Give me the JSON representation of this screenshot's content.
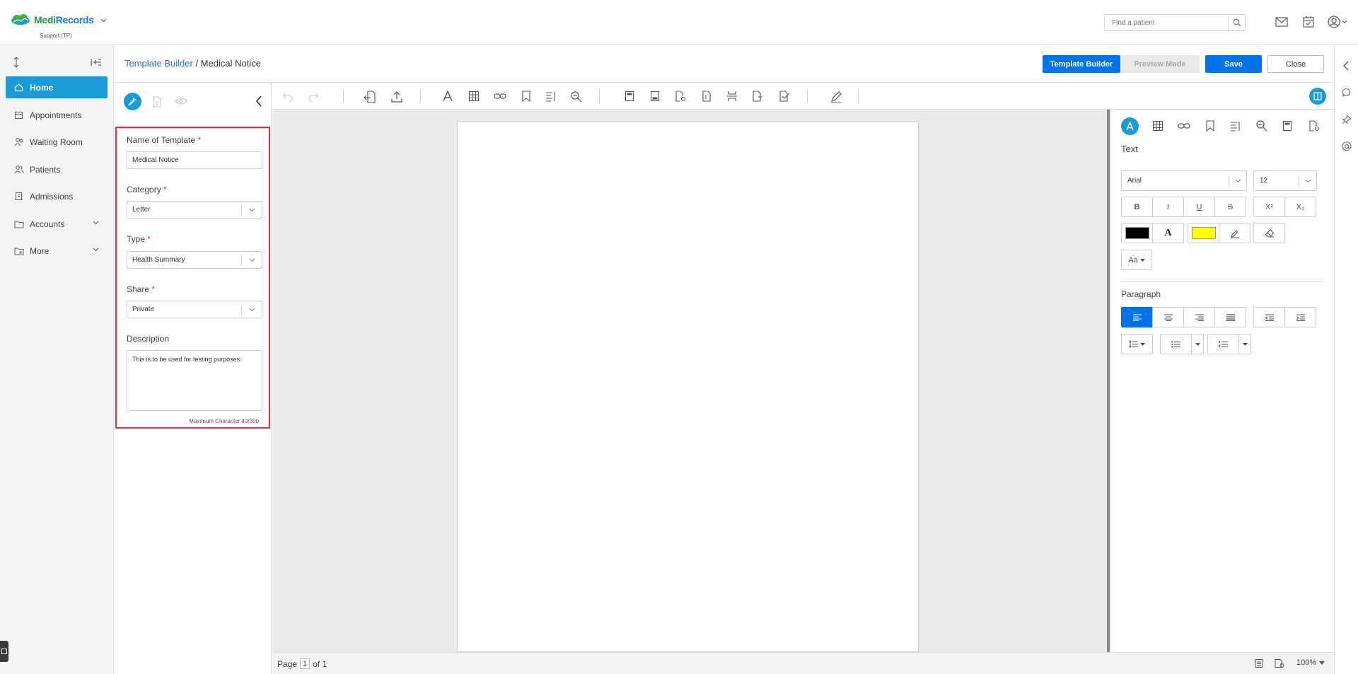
{
  "header": {
    "brand": "MediRecords",
    "brand_prefix": "Medi",
    "brand_suffix": "Records",
    "org": "Support (TP)",
    "search_placeholder": "Find a patient"
  },
  "sidebar": {
    "items": [
      {
        "label": "Home",
        "icon": "home-icon",
        "active": true
      },
      {
        "label": "Appointments",
        "icon": "calendar-icon"
      },
      {
        "label": "Waiting Room",
        "icon": "users-icon"
      },
      {
        "label": "Patients",
        "icon": "people-icon"
      },
      {
        "label": "Admissions",
        "icon": "building-icon"
      },
      {
        "label": "Accounts",
        "icon": "folder-icon",
        "expandable": true
      },
      {
        "label": "More",
        "icon": "folder-plus-icon",
        "expandable": true
      }
    ]
  },
  "breadcrumb": {
    "parent": "Template Builder",
    "separator": " / ",
    "current": "Medical Notice"
  },
  "actions": {
    "template_builder": "Template Builder",
    "preview_mode": "Preview Mode",
    "save": "Save",
    "close": "Close"
  },
  "form": {
    "name_label": "Name of Template",
    "name_value": "Medical Notice",
    "category_label": "Category",
    "category_value": "Letter",
    "type_label": "Type",
    "type_value": "Health Summary",
    "share_label": "Share",
    "share_value": "Private",
    "description_label": "Description",
    "description_value": "This is to be used for testing purposes.",
    "char_count": "Maximum Character 40/300",
    "required_mark": "*"
  },
  "statusbar": {
    "page_label": "Page",
    "page_number": "1",
    "page_of": "of 1",
    "zoom": "100%"
  },
  "format_panel": {
    "text_heading": "Text",
    "font_family": "Arial",
    "font_size": "12",
    "case_label": "Aa",
    "paragraph_heading": "Paragraph",
    "style_buttons": [
      "B",
      "I",
      "U",
      "S",
      "X²",
      "X₂"
    ],
    "text_color": "#000000",
    "highlight_color": "#ffff00"
  },
  "colors": {
    "accent": "#0073e6",
    "nav_active": "#1a9bd7",
    "highlight_border": "#e0303a"
  }
}
